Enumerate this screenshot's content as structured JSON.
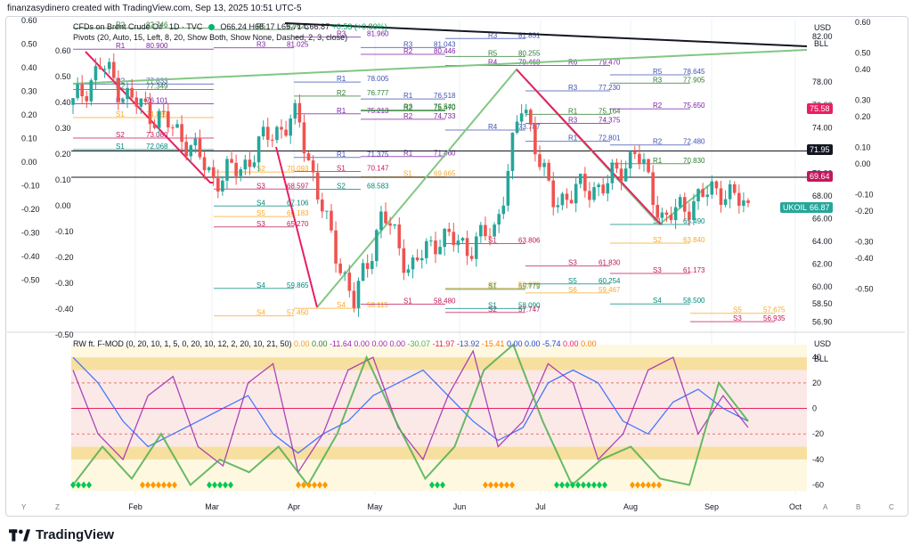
{
  "header": {
    "text": "finanzasydinero created with TradingView.com, Sep 13, 2025 10:51 UTC-5"
  },
  "main_legend": {
    "symbol": "CFDs on Brent Crude Oil · 1D · TVC",
    "o": "O66.24",
    "h": "H68.17",
    "l": "L65.71",
    "c": "C66.87",
    "change": "+0.53 (+0.80%)",
    "pivots": "Pivots (20, Auto, 15, Left, 8, 20, Show Both, Show None, Dashed, 2, 3, close)"
  },
  "osc_legend": {
    "name": "RW ft. F-MOD (0, 20, 10, 1, 5, 0, 20, 10, 12, 2, 20, 10, 21, 50)",
    "values": [
      {
        "v": "0.00",
        "c": "#f0a020"
      },
      {
        "v": "0.00",
        "c": "#2e7d32"
      },
      {
        "v": "-11.64",
        "c": "#9c27b0"
      },
      {
        "v": "0.00",
        "c": "#9c27b0"
      },
      {
        "v": "0.00",
        "c": "#9c27b0"
      },
      {
        "v": "0.00",
        "c": "#9c27b0"
      },
      {
        "v": "-30.07",
        "c": "#4caf50"
      },
      {
        "v": "-11.97",
        "c": "#e91e63"
      },
      {
        "v": "-13.92",
        "c": "#3f51b5"
      },
      {
        "v": "-15.41",
        "c": "#f57c00"
      },
      {
        "v": "0.00",
        "c": "#1e40c8"
      },
      {
        "v": "0.00",
        "c": "#1e40c8"
      },
      {
        "v": "-5.74",
        "c": "#1e40c8"
      },
      {
        "v": "0.00",
        "c": "#e91e63"
      },
      {
        "v": "0.00",
        "c": "#f57c00"
      }
    ]
  },
  "currency": {
    "top": "USD",
    "bll": "BLL",
    "osc_top": "USD",
    "osc_bll": "BLL"
  },
  "price_badges": [
    {
      "label": "75.58",
      "value": 75.58,
      "color": "#e91e63"
    },
    {
      "label": "71.95",
      "value": 71.95,
      "color": "#131722"
    },
    {
      "label": "69.64",
      "value": 69.64,
      "color": "#c2185b"
    },
    {
      "label": "66.87",
      "value": 66.87,
      "color": "#26a69a",
      "name": "UKOIL"
    }
  ],
  "footer": {
    "brand": "TradingView"
  },
  "chart_data": [
    {
      "type": "candlestick",
      "title": "CFDs on Brent Crude Oil · 1D · TVC",
      "x_ticks": [
        "Feb",
        "Mar",
        "Apr",
        "May",
        "Jun",
        "Jul",
        "Aug",
        "Sep",
        "Oct"
      ],
      "y_ticks": [
        56.9,
        58.5,
        60.0,
        62.0,
        64.0,
        66.0,
        68.0,
        70.0,
        72.0,
        74.0,
        76.0,
        78.0,
        82.0
      ],
      "left_axis_ticks": [
        "0.60",
        "0.50",
        "0.40",
        "0.30",
        "0.20",
        "0.10",
        "0.00",
        "-0.10",
        "-0.20",
        "-0.30",
        "-0.40",
        "-0.50"
      ],
      "ylim": [
        56.4,
        83.5
      ],
      "close_path": [
        {
          "x": "Jan",
          "y": 76.0
        },
        {
          "x": "Jan mid",
          "y": 79.5
        },
        {
          "x": "Feb start",
          "y": 76.5
        },
        {
          "x": "Feb mid",
          "y": 75.0
        },
        {
          "x": "Feb end",
          "y": 73.0
        },
        {
          "x": "Mar start",
          "y": 69.5
        },
        {
          "x": "Mar mid",
          "y": 70.5
        },
        {
          "x": "Mar end",
          "y": 73.5
        },
        {
          "x": "Apr start",
          "y": 74.8
        },
        {
          "x": "Apr early",
          "y": 65.5
        },
        {
          "x": "Apr mid",
          "y": 58.5
        },
        {
          "x": "Apr late",
          "y": 66.5
        },
        {
          "x": "May start",
          "y": 61.5
        },
        {
          "x": "May mid",
          "y": 64.5
        },
        {
          "x": "May end",
          "y": 63.5
        },
        {
          "x": "Jun start",
          "y": 65.0
        },
        {
          "x": "Jun mid",
          "y": 76.5
        },
        {
          "x": "Jun late",
          "y": 67.5
        },
        {
          "x": "Jul start",
          "y": 68.5
        },
        {
          "x": "Jul mid",
          "y": 69.0
        },
        {
          "x": "Aug start",
          "y": 72.0
        },
        {
          "x": "Aug mid",
          "y": 65.8
        },
        {
          "x": "Aug end",
          "y": 67.5
        },
        {
          "x": "Sep start",
          "y": 68.7
        },
        {
          "x": "Sep mid",
          "y": 66.87
        }
      ],
      "pivot_levels": [
        {
          "l": "R2",
          "v": "85.855"
        },
        {
          "l": "R2",
          "v": "82.746"
        },
        {
          "l": "R1",
          "v": "80.900"
        },
        {
          "l": "R2",
          "v": "77.833"
        },
        {
          "l": "R2",
          "v": "77.349"
        },
        {
          "l": "R1",
          "v": "76.101"
        },
        {
          "l": "S1",
          "v": "74.889"
        },
        {
          "l": "S2",
          "v": "73.080"
        },
        {
          "l": "S1",
          "v": "72.068"
        },
        {
          "l": "S2",
          "v": "70.093"
        },
        {
          "l": "S3",
          "v": "68.597"
        },
        {
          "l": "S4",
          "v": "67.106"
        },
        {
          "l": "S5",
          "v": "66.183"
        },
        {
          "l": "S3",
          "v": "65.270"
        },
        {
          "l": "S4",
          "v": "59.865"
        },
        {
          "l": "S4",
          "v": "57.450"
        },
        {
          "l": "R5",
          "v": "82.625"
        },
        {
          "l": "R3",
          "v": "81.025"
        },
        {
          "l": "R1",
          "v": "78.005"
        },
        {
          "l": "R2",
          "v": "76.777"
        },
        {
          "l": "R1",
          "v": "75.213"
        },
        {
          "l": "R1",
          "v": "71.375"
        },
        {
          "l": "S1",
          "v": "70.147"
        },
        {
          "l": "S2",
          "v": "68.583"
        },
        {
          "l": "S4",
          "v": "58.115"
        },
        {
          "l": "R4",
          "v": "83.830"
        },
        {
          "l": "R3",
          "v": "81.960"
        },
        {
          "l": "R3",
          "v": "81.043"
        },
        {
          "l": "R2",
          "v": "75.470"
        },
        {
          "l": "R1",
          "v": "71.460"
        },
        {
          "l": "S1",
          "v": "69.665"
        },
        {
          "l": "S1",
          "v": "58.480"
        },
        {
          "l": "R2",
          "v": "80.446"
        },
        {
          "l": "R1",
          "v": "76.518"
        },
        {
          "l": "R3",
          "v": "75.540"
        },
        {
          "l": "R2",
          "v": "74.733"
        },
        {
          "l": "R4",
          "v": "73.787"
        },
        {
          "l": "S1",
          "v": "63.806"
        },
        {
          "l": "S1",
          "v": "59.779"
        },
        {
          "l": "S2",
          "v": "59.878"
        },
        {
          "l": "S2",
          "v": "57.747"
        },
        {
          "l": "S1",
          "v": "58.090"
        },
        {
          "l": "R3",
          "v": "81.831"
        },
        {
          "l": "R5",
          "v": "80.255"
        },
        {
          "l": "R4",
          "v": "79.468"
        },
        {
          "l": "R3",
          "v": "77.230"
        },
        {
          "l": "R1",
          "v": "75.164"
        },
        {
          "l": "R3",
          "v": "74.375"
        },
        {
          "l": "R1",
          "v": "72.801"
        },
        {
          "l": "S3",
          "v": "61.830"
        },
        {
          "l": "S5",
          "v": "60.254"
        },
        {
          "l": "S6",
          "v": "59.467"
        },
        {
          "l": "R4",
          "v": "84.895"
        },
        {
          "l": "R6",
          "v": "79.470"
        },
        {
          "l": "R5",
          "v": "78.645"
        },
        {
          "l": "R3",
          "v": "77.905"
        },
        {
          "l": "R2",
          "v": "75.650"
        },
        {
          "l": "R2",
          "v": "72.480"
        },
        {
          "l": "R1",
          "v": "70.830"
        },
        {
          "l": "S1",
          "v": "65.490"
        },
        {
          "l": "S2",
          "v": "63.840"
        },
        {
          "l": "S3",
          "v": "61.173"
        },
        {
          "l": "S4",
          "v": "58.500"
        },
        {
          "l": "S5",
          "v": "57.675"
        },
        {
          "l": "S3",
          "v": "56.935"
        }
      ],
      "trendlines": [
        {
          "name": "black-resistance",
          "from": [
            1,
            84.0
          ],
          "to": [
            11,
            81.6
          ]
        },
        {
          "name": "green-support",
          "from": [
            1,
            78.3
          ],
          "to": [
            11,
            81.1
          ]
        }
      ]
    },
    {
      "type": "line",
      "title": "RW ft. F-MOD",
      "y_ticks": [
        40,
        20,
        0,
        -20,
        -40,
        -60
      ],
      "ylim": [
        -68,
        52
      ],
      "series": [
        {
          "name": "",
          "color": "#2962ff",
          "values": [
            40,
            20,
            -10,
            -30,
            -20,
            -10,
            0,
            10,
            -20,
            -35,
            -20,
            -10,
            10,
            20,
            30,
            10,
            -10,
            -25,
            -15,
            20,
            30,
            20,
            -10,
            -20,
            5,
            15,
            0,
            -10
          ]
        },
        {
          "name": "",
          "color": "#9c27b0",
          "values": [
            30,
            -20,
            -40,
            10,
            25,
            -30,
            -45,
            20,
            35,
            -50,
            -20,
            30,
            40,
            -15,
            -40,
            10,
            45,
            -30,
            -10,
            35,
            20,
            -40,
            -20,
            30,
            40,
            -20,
            10,
            -15
          ]
        },
        {
          "name": "",
          "color": "#4caf50",
          "values": [
            -60,
            -30,
            -55,
            -20,
            -60,
            -40,
            -50,
            -30,
            -60,
            -20,
            40,
            -10,
            -55,
            -30,
            30,
            50,
            -10,
            -60,
            -40,
            -30,
            -55,
            -60,
            20,
            -10
          ]
        }
      ]
    }
  ]
}
